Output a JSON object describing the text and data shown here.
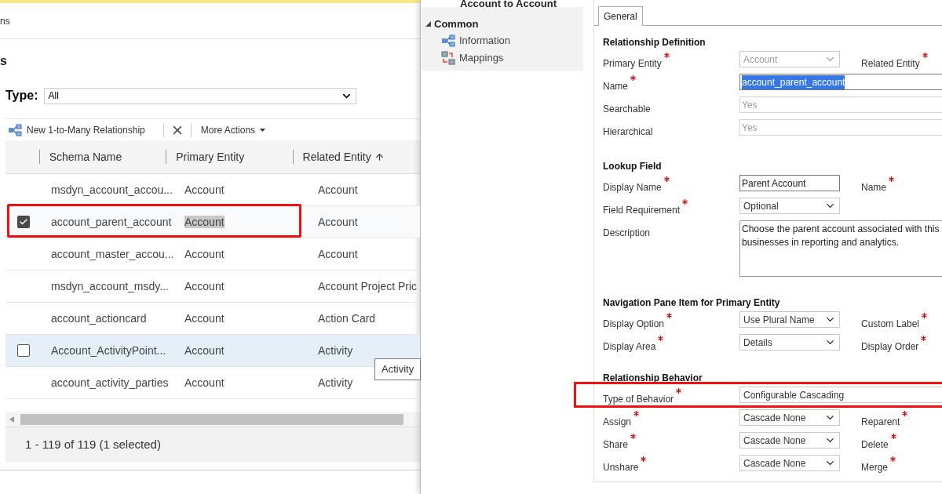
{
  "left": {
    "crumb": "ns",
    "heading": "s",
    "type_filter": {
      "label": "Type:",
      "value": "All"
    },
    "toolbar": [
      {
        "kind": "new",
        "label": "New 1-to-Many Relationship"
      },
      {
        "kind": "delete"
      },
      {
        "kind": "more",
        "label": "More Actions"
      }
    ],
    "columns": [
      {
        "label": "Schema Name",
        "sorted": false
      },
      {
        "label": "Primary Entity",
        "sorted": false
      },
      {
        "label": "Related Entity",
        "sorted": true
      }
    ],
    "rows": [
      {
        "schema": "msdyn_account_accou...",
        "primary": "Account",
        "related": "Account",
        "checked": false,
        "hovered": false,
        "primary_highlighted": false,
        "annotated": false
      },
      {
        "schema": "account_parent_account",
        "primary": "Account",
        "related": "Account",
        "checked": true,
        "hovered": false,
        "primary_highlighted": true,
        "annotated": true
      },
      {
        "schema": "account_master_accou...",
        "primary": "Account",
        "related": "Account",
        "checked": false,
        "hovered": false,
        "primary_highlighted": false,
        "annotated": false
      },
      {
        "schema": "msdyn_account_msdy...",
        "primary": "Account",
        "related": "Account Project Pric",
        "checked": false,
        "hovered": false,
        "primary_highlighted": false,
        "annotated": false
      },
      {
        "schema": "account_actioncard",
        "primary": "Account",
        "related": "Action Card",
        "checked": false,
        "hovered": false,
        "primary_highlighted": false,
        "annotated": false
      },
      {
        "schema": "Account_ActivityPoint...",
        "primary": "Account",
        "related": "Activity",
        "checked": false,
        "hovered": true,
        "primary_highlighted": false,
        "annotated": false
      },
      {
        "schema": "account_activity_parties",
        "primary": "Account",
        "related": "Activity",
        "checked": false,
        "hovered": false,
        "primary_highlighted": false,
        "annotated": false
      }
    ],
    "tooltip": "Activity",
    "footer": "1 - 119 of 119 (1 selected)"
  },
  "right": {
    "title": "Account to Account",
    "nav": {
      "group": "Common",
      "expanded": true,
      "items": [
        {
          "kind": "information",
          "label": "Information"
        },
        {
          "kind": "mappings",
          "label": "Mappings"
        }
      ]
    },
    "tabs": [
      {
        "label": "General",
        "selected": true
      }
    ],
    "sections": [
      {
        "title": "Relationship Definition",
        "fields": [
          {
            "label": "Primary Entity",
            "required": true,
            "control": {
              "kind": "select",
              "value": "Account",
              "disabled": true
            },
            "side": {
              "label": "Related Entity",
              "required": true
            }
          },
          {
            "label": "Name",
            "required": true,
            "control": {
              "kind": "input",
              "value": "account_parent_account",
              "wide": true,
              "text_selected": true
            }
          },
          {
            "label": "Searchable",
            "required": false,
            "control": {
              "kind": "input",
              "value": "Yes",
              "wide": true,
              "disabled": true
            }
          },
          {
            "label": "Hierarchical",
            "required": false,
            "control": {
              "kind": "input",
              "value": "Yes",
              "wide": true,
              "disabled": true
            }
          }
        ]
      },
      {
        "title": "Lookup Field",
        "fields": [
          {
            "label": "Display Name",
            "required": true,
            "control": {
              "kind": "input",
              "value": "Parent Account"
            },
            "side": {
              "label": "Name",
              "required": true
            }
          },
          {
            "label": "Field Requirement",
            "required": true,
            "control": {
              "kind": "select",
              "value": "Optional"
            }
          },
          {
            "label": "Description",
            "required": false,
            "control": {
              "kind": "textarea",
              "lines": [
                "Choose the parent account associated with this",
                "businesses in reporting and analytics."
              ]
            }
          }
        ]
      },
      {
        "title": "Navigation Pane Item for Primary Entity",
        "fields": [
          {
            "label": "Display Option",
            "required": true,
            "control": {
              "kind": "select",
              "value": "Use Plural Name"
            },
            "side": {
              "label": "Custom Label",
              "required": true
            }
          },
          {
            "label": "Display Area",
            "required": true,
            "control": {
              "kind": "select",
              "value": "Details"
            },
            "side": {
              "label": "Display Order",
              "required": true
            }
          }
        ]
      },
      {
        "title": "Relationship Behavior",
        "fields": [
          {
            "label": "Type of Behavior",
            "required": true,
            "annotated": true,
            "control": {
              "kind": "select",
              "value": "Configurable Cascading",
              "wide": true
            }
          },
          {
            "label": "Assign",
            "required": true,
            "control": {
              "kind": "select",
              "value": "Cascade None"
            },
            "side": {
              "label": "Reparent",
              "required": true
            }
          },
          {
            "label": "Share",
            "required": true,
            "control": {
              "kind": "select",
              "value": "Cascade None"
            },
            "side": {
              "label": "Delete",
              "required": true
            }
          },
          {
            "label": "Unshare",
            "required": true,
            "control": {
              "kind": "select",
              "value": "Cascade None"
            },
            "side": {
              "label": "Merge",
              "required": true
            }
          }
        ]
      }
    ]
  }
}
